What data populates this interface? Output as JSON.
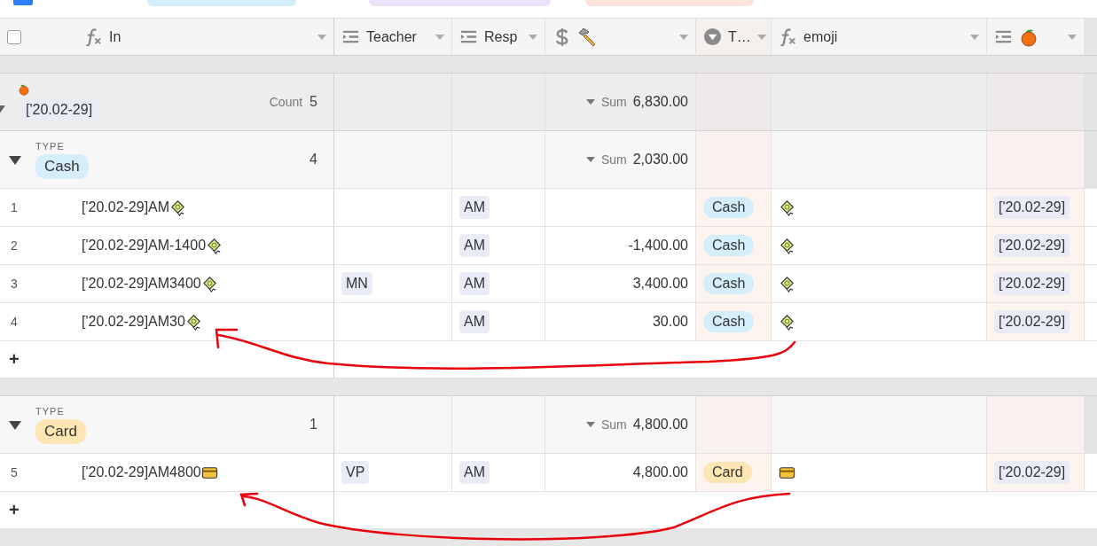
{
  "toolbar": {
    "chips": [
      {
        "color": "#d3eefb"
      },
      {
        "color": "#ece1fb"
      },
      {
        "color": "#fde4da"
      }
    ]
  },
  "header": {
    "checkbox": {
      "checked": false
    },
    "columns": [
      {
        "kind": "formula",
        "label": "In"
      },
      {
        "kind": "lookup",
        "label": "Teacher"
      },
      {
        "kind": "lookup",
        "label": "Resp"
      },
      {
        "kind": "currency"
      },
      {
        "kind": "select",
        "label": "T…"
      },
      {
        "kind": "formula",
        "label": "emoji"
      },
      {
        "kind": "lookup"
      }
    ]
  },
  "group": {
    "expanded": true,
    "label": "['20.02-29]",
    "count_label": "Count",
    "count": "5",
    "sum_label": "Sum",
    "sum": "6,830.00",
    "subgroups": [
      {
        "field": "TYPE",
        "value": "Cash",
        "color": "#d4eefb",
        "expanded": true,
        "count": "4",
        "sum_label": "Sum",
        "sum": "2,030.00",
        "add": "+",
        "rows": [
          {
            "number": "1",
            "in": "['20.02-29]AM",
            "kind": "banknote",
            "resp": "AM",
            "type": "Cash",
            "date": "['20.02-29]"
          },
          {
            "number": "2",
            "in": "['20.02-29]AM-1400",
            "kind": "banknote",
            "resp": "AM",
            "amount": "-1,400.00",
            "type": "Cash",
            "date": "['20.02-29]"
          },
          {
            "number": "3",
            "in": "['20.02-29]AM3400",
            "kind": "banknote",
            "teacher": "MN",
            "resp": "AM",
            "amount": "3,400.00",
            "type": "Cash",
            "date": "['20.02-29]"
          },
          {
            "number": "4",
            "in": "['20.02-29]AM30",
            "kind": "banknote",
            "resp": "AM",
            "amount": "30.00",
            "type": "Cash",
            "date": "['20.02-29]"
          }
        ]
      },
      {
        "field": "TYPE",
        "value": "Card",
        "color": "#fee6b4",
        "expanded": true,
        "count": "1",
        "sum_label": "Sum",
        "sum": "4,800.00",
        "add": "+",
        "rows": [
          {
            "number": "5",
            "in": "['20.02-29]AM4800",
            "kind": "card",
            "teacher": "VP",
            "resp": "AM",
            "amount": "4,800.00",
            "type": "Card",
            "date": "['20.02-29]"
          }
        ]
      }
    ]
  }
}
